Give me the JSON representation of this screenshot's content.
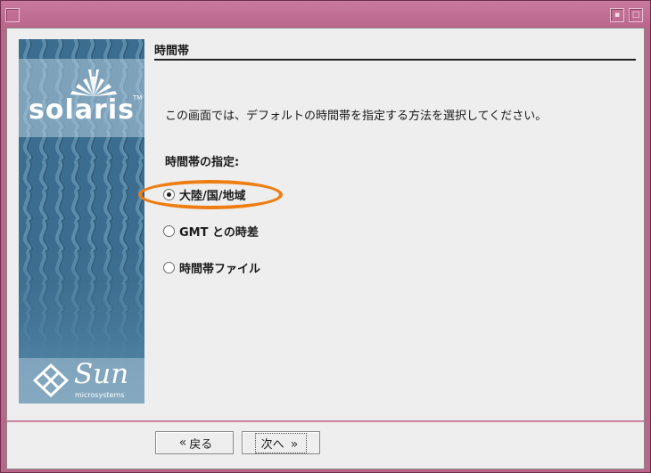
{
  "window": {
    "title_buttons": [
      "dot-icon",
      "maximize-icon"
    ]
  },
  "sidebar": {
    "brand": "solaris",
    "brand_tm": "TM",
    "vendor": "Sun",
    "vendor_sub": "microsystems"
  },
  "main": {
    "heading": "時間帯",
    "description": "この画面では、デフォルトの時間帯を指定する方法を選択してください。",
    "group_label": "時間帯の指定:",
    "options": [
      {
        "label": "大陸/国/地域",
        "checked": true
      },
      {
        "label": "GMT との時差",
        "checked": false
      },
      {
        "label": "時間帯ファイル",
        "checked": false
      }
    ]
  },
  "footer": {
    "back_label": "戻る",
    "next_label": "次へ"
  },
  "colors": {
    "window_frame": "#b9668a",
    "sidebar": "#3d6d8e",
    "highlight": "#ee7d12"
  }
}
